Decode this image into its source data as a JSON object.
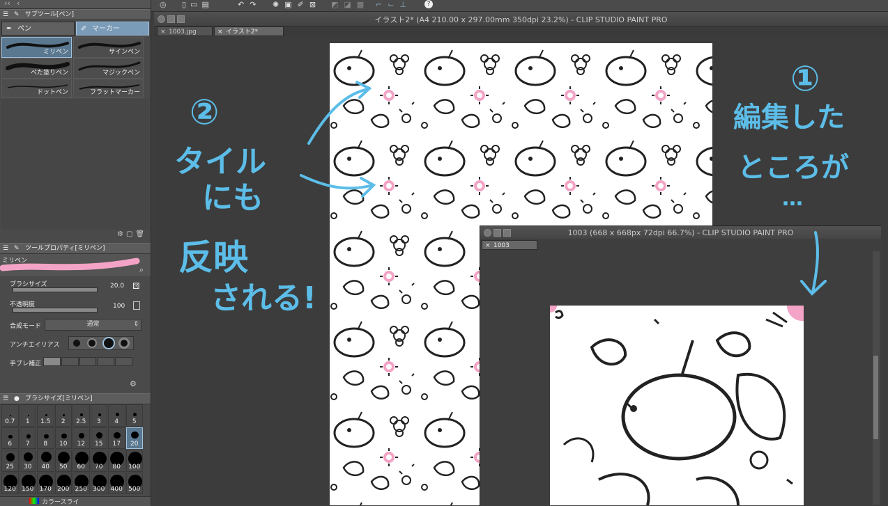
{
  "subtool_panel": {
    "title": "サブツール[ペン]",
    "tabs": [
      {
        "label": "ペン",
        "selected": false
      },
      {
        "label": "マーカー",
        "selected": true
      }
    ],
    "brushes": [
      {
        "label": "ミリペン",
        "selected": true
      },
      {
        "label": "サインペン",
        "selected": false
      },
      {
        "label": "べた塗りペン",
        "selected": false
      },
      {
        "label": "マジックペン",
        "selected": false
      },
      {
        "label": "ドットペン",
        "selected": false
      },
      {
        "label": "フラットマーカー",
        "selected": false
      }
    ]
  },
  "tool_property": {
    "title": "ツールプロパティ[ミリペン]",
    "preview_label": "ミリペン",
    "brush_size_label": "ブラシサイズ",
    "brush_size_value": "20.0",
    "opacity_label": "不透明度",
    "opacity_value": "100",
    "blend_label": "合成モード",
    "blend_value": "通常",
    "antialias_label": "アンチエイリアス",
    "stabilizer_label": "手ブレ補正"
  },
  "brush_size_panel": {
    "title": "ブラシサイズ[ミリペン]",
    "sizes": [
      "0.7",
      "1",
      "1.5",
      "2",
      "2.5",
      "3",
      "4",
      "5",
      "6",
      "7",
      "8",
      "10",
      "12",
      "15",
      "17",
      "20",
      "25",
      "30",
      "40",
      "50",
      "60",
      "70",
      "80",
      "100",
      "120",
      "150",
      "170",
      "200",
      "250",
      "300",
      "400",
      "500"
    ],
    "selected": "20",
    "bottom_tab": "カラースライ"
  },
  "main_window": {
    "title": "イラスト2* (A4 210.00 x 297.00mm 350dpi 23.2%)  - CLIP STUDIO PAINT PRO",
    "tabs": [
      {
        "label": "1003.jpg",
        "selected": false
      },
      {
        "label": "イラスト2*",
        "selected": true
      }
    ]
  },
  "second_window": {
    "title": "1003 (668 x 668px 72dpi 66.7%)  - CLIP STUDIO PAINT PRO",
    "tab": "1003"
  },
  "annotations": {
    "left_number": "②",
    "left_line1": "タイル",
    "left_line2": "にも",
    "left_line3": "反映",
    "left_line4": "される!",
    "right_number": "①",
    "right_line1": "編集した",
    "right_line2": "ところが",
    "right_dots": "…"
  },
  "colors": {
    "accent_pink": "#f3a3c5",
    "annotation_blue": "#5cbde8",
    "selected_tab": "#7b9cb8"
  }
}
